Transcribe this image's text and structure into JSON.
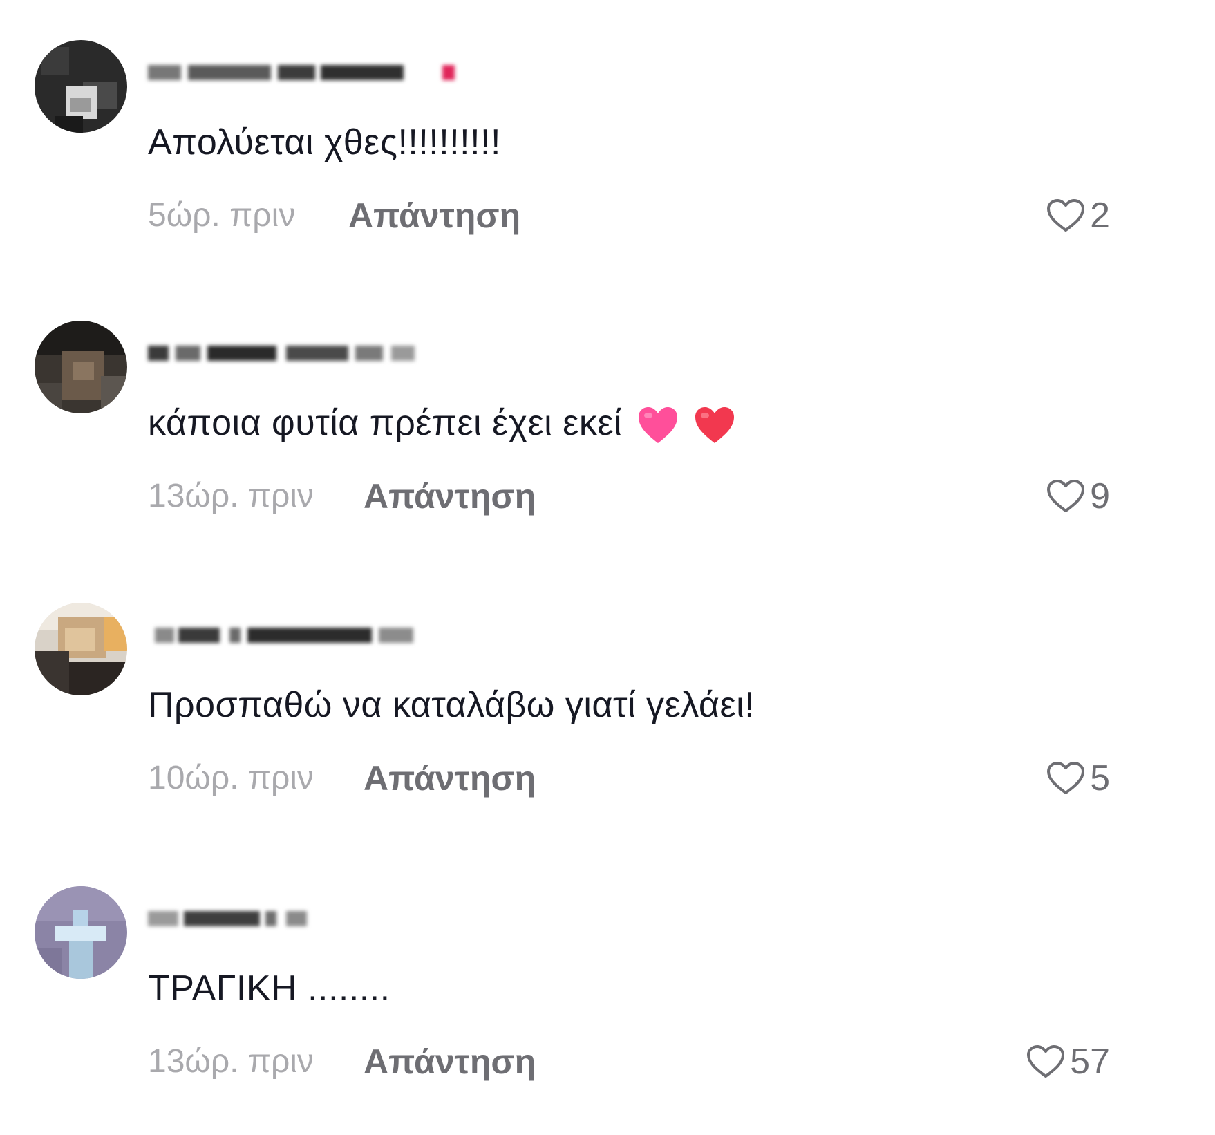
{
  "comments": [
    {
      "username_redacted": true,
      "text": "Απολύεται χθες!!!!!!!!!!",
      "timestamp": "5ώρ. πριν",
      "reply_label": "Απάντηση",
      "likes": "2",
      "has_heart_emojis": false
    },
    {
      "username_redacted": true,
      "text": "κάποια φυτία πρέπει έχει εκεί",
      "timestamp": "13ώρ. πριν",
      "reply_label": "Απάντηση",
      "likes": "9",
      "has_heart_emojis": true
    },
    {
      "username_redacted": true,
      "text": "Προσπαθώ να καταλάβω γιατί γελάει!",
      "timestamp": "10ώρ. πριν",
      "reply_label": "Απάντηση",
      "likes": "5",
      "has_heart_emojis": false
    },
    {
      "username_redacted": true,
      "text": "ΤΡΑΓΙΚΗ ........",
      "timestamp": "13ώρ. πριν",
      "reply_label": "Απάντηση",
      "likes": "57",
      "has_heart_emojis": false
    }
  ],
  "colors": {
    "text": "#161823",
    "timestamp": "#a9a9ad",
    "secondary": "#6e6e73",
    "emoji_pink": "#ff4f9a",
    "emoji_red": "#f2384f"
  },
  "icons": {
    "like": "heart-outline-icon",
    "emoji": "heart-emoji-icon"
  }
}
